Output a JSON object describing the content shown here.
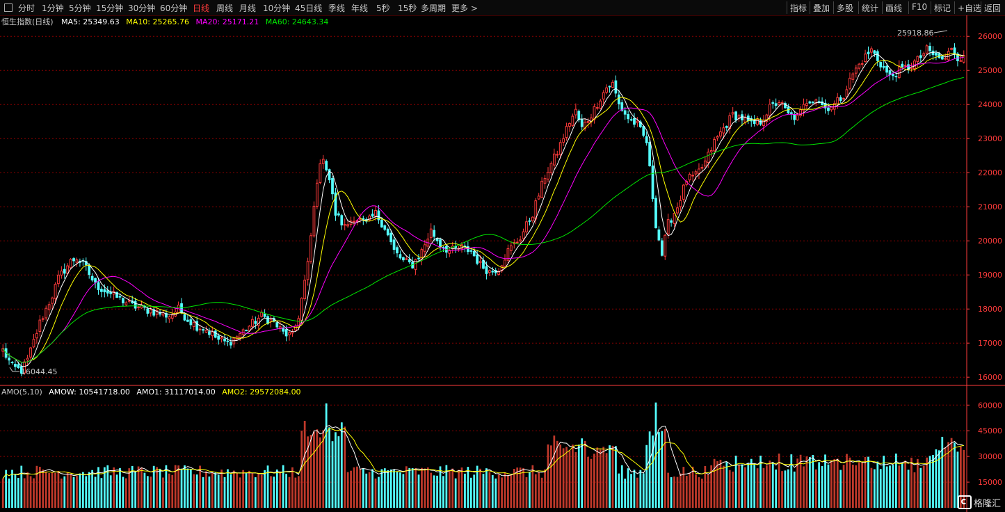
{
  "toolbar": {
    "periods": [
      {
        "label": "分时",
        "active": false
      },
      {
        "label": "1分钟",
        "active": false
      },
      {
        "label": "5分钟",
        "active": false
      },
      {
        "label": "15分钟",
        "active": false
      },
      {
        "label": "30分钟",
        "active": false
      },
      {
        "label": "60分钟",
        "active": false
      },
      {
        "label": "日线",
        "active": true
      },
      {
        "label": "周线",
        "active": false
      },
      {
        "label": "月线",
        "active": false
      },
      {
        "label": "10分钟",
        "active": false
      },
      {
        "label": "45日线",
        "active": false
      },
      {
        "label": "季线",
        "active": false
      },
      {
        "label": "年线",
        "active": false
      },
      {
        "label": "5秒",
        "active": false
      },
      {
        "label": "15秒",
        "active": false
      },
      {
        "label": "多周期",
        "active": false
      },
      {
        "label": "更多",
        "active": false
      }
    ],
    "tools": [
      "指标",
      "叠加",
      "多股",
      "统计",
      "画线",
      "F10",
      "标记",
      "+自选",
      "返回"
    ]
  },
  "price_legend": {
    "name": "恒生指数(日线)",
    "ma5": "MA5: 25349.63",
    "ma10": "MA10: 25265.76",
    "ma20": "MA20: 25171.21",
    "ma60": "MA60: 24643.34"
  },
  "volume_legend": {
    "name": "AMO(5,10)",
    "amow": "AMOW: 10541718.00",
    "amo1": "AMO1: 31117014.00",
    "amo2": "AMO2: 29572084.00"
  },
  "annotations": {
    "high_label": "25918.86",
    "low_label": "16044.45"
  },
  "logo": {
    "text": "格隆汇"
  },
  "colors": {
    "up": "#ff3b3b",
    "down": "#54ffff",
    "ma5": "#ffffff",
    "ma10": "#ffff00",
    "ma20": "#ff00ff",
    "ma60": "#00e600",
    "axis": "#ff3b3b",
    "grid": "#8b0000"
  },
  "chart_data": {
    "type": "candlestick",
    "y_ticks": [
      "26000",
      "25000",
      "24000",
      "23000",
      "22000",
      "21000",
      "20000",
      "19000",
      "18000",
      "17000",
      "16000"
    ],
    "ylim": [
      15800,
      26250
    ],
    "volume_ticks": [
      "60000",
      "45000",
      "30000",
      "15000"
    ],
    "volume_ylim": [
      0,
      65000
    ],
    "close_path": [
      [
        0,
        16800
      ],
      [
        3,
        16300
      ],
      [
        6,
        16200
      ],
      [
        8,
        16500
      ],
      [
        12,
        17600
      ],
      [
        16,
        18400
      ],
      [
        18,
        18900
      ],
      [
        22,
        19400
      ],
      [
        24,
        19500
      ],
      [
        27,
        19200
      ],
      [
        30,
        18700
      ],
      [
        34,
        18500
      ],
      [
        38,
        18300
      ],
      [
        42,
        18100
      ],
      [
        46,
        18000
      ],
      [
        50,
        17900
      ],
      [
        54,
        17800
      ],
      [
        57,
        18000
      ],
      [
        60,
        17700
      ],
      [
        63,
        17500
      ],
      [
        66,
        17400
      ],
      [
        70,
        17100
      ],
      [
        73,
        17000
      ],
      [
        76,
        17200
      ],
      [
        80,
        17500
      ],
      [
        84,
        17800
      ],
      [
        88,
        17600
      ],
      [
        91,
        17300
      ],
      [
        94,
        17200
      ],
      [
        96,
        17800
      ],
      [
        99,
        19300
      ],
      [
        102,
        21800
      ],
      [
        104,
        22500
      ],
      [
        106,
        21800
      ],
      [
        108,
        20800
      ],
      [
        111,
        20400
      ],
      [
        114,
        20700
      ],
      [
        118,
        20500
      ],
      [
        121,
        20800
      ],
      [
        124,
        20400
      ],
      [
        127,
        19700
      ],
      [
        130,
        19400
      ],
      [
        133,
        19300
      ],
      [
        136,
        19700
      ],
      [
        139,
        20300
      ],
      [
        142,
        19900
      ],
      [
        145,
        19700
      ],
      [
        149,
        19800
      ],
      [
        152,
        19700
      ],
      [
        155,
        19300
      ],
      [
        158,
        19100
      ],
      [
        161,
        19200
      ],
      [
        164,
        19700
      ],
      [
        168,
        20100
      ],
      [
        172,
        20800
      ],
      [
        176,
        21900
      ],
      [
        180,
        22600
      ],
      [
        184,
        23500
      ],
      [
        186,
        23800
      ],
      [
        188,
        23300
      ],
      [
        191,
        23700
      ],
      [
        194,
        24200
      ],
      [
        196,
        24500
      ],
      [
        198,
        24600
      ],
      [
        200,
        24000
      ],
      [
        203,
        23600
      ],
      [
        206,
        23400
      ],
      [
        209,
        22900
      ],
      [
        212,
        20500
      ],
      [
        214,
        19600
      ],
      [
        216,
        20500
      ],
      [
        219,
        21000
      ],
      [
        222,
        21800
      ],
      [
        225,
        21900
      ],
      [
        228,
        22300
      ],
      [
        231,
        22900
      ],
      [
        234,
        23300
      ],
      [
        237,
        23700
      ],
      [
        240,
        23600
      ],
      [
        243,
        23400
      ],
      [
        246,
        23500
      ],
      [
        249,
        23900
      ],
      [
        252,
        24100
      ],
      [
        255,
        23700
      ],
      [
        258,
        23600
      ],
      [
        261,
        24100
      ],
      [
        264,
        24200
      ],
      [
        267,
        23900
      ],
      [
        270,
        24000
      ],
      [
        273,
        24300
      ],
      [
        276,
        24900
      ],
      [
        279,
        25300
      ],
      [
        282,
        25600
      ],
      [
        285,
        25200
      ],
      [
        288,
        24800
      ],
      [
        291,
        25000
      ],
      [
        294,
        25100
      ],
      [
        297,
        25300
      ],
      [
        300,
        25600
      ],
      [
        303,
        25400
      ],
      [
        306,
        25300
      ],
      [
        308,
        25700
      ],
      [
        310,
        25400
      ],
      [
        312,
        25350
      ]
    ],
    "bar_count": 313
  }
}
